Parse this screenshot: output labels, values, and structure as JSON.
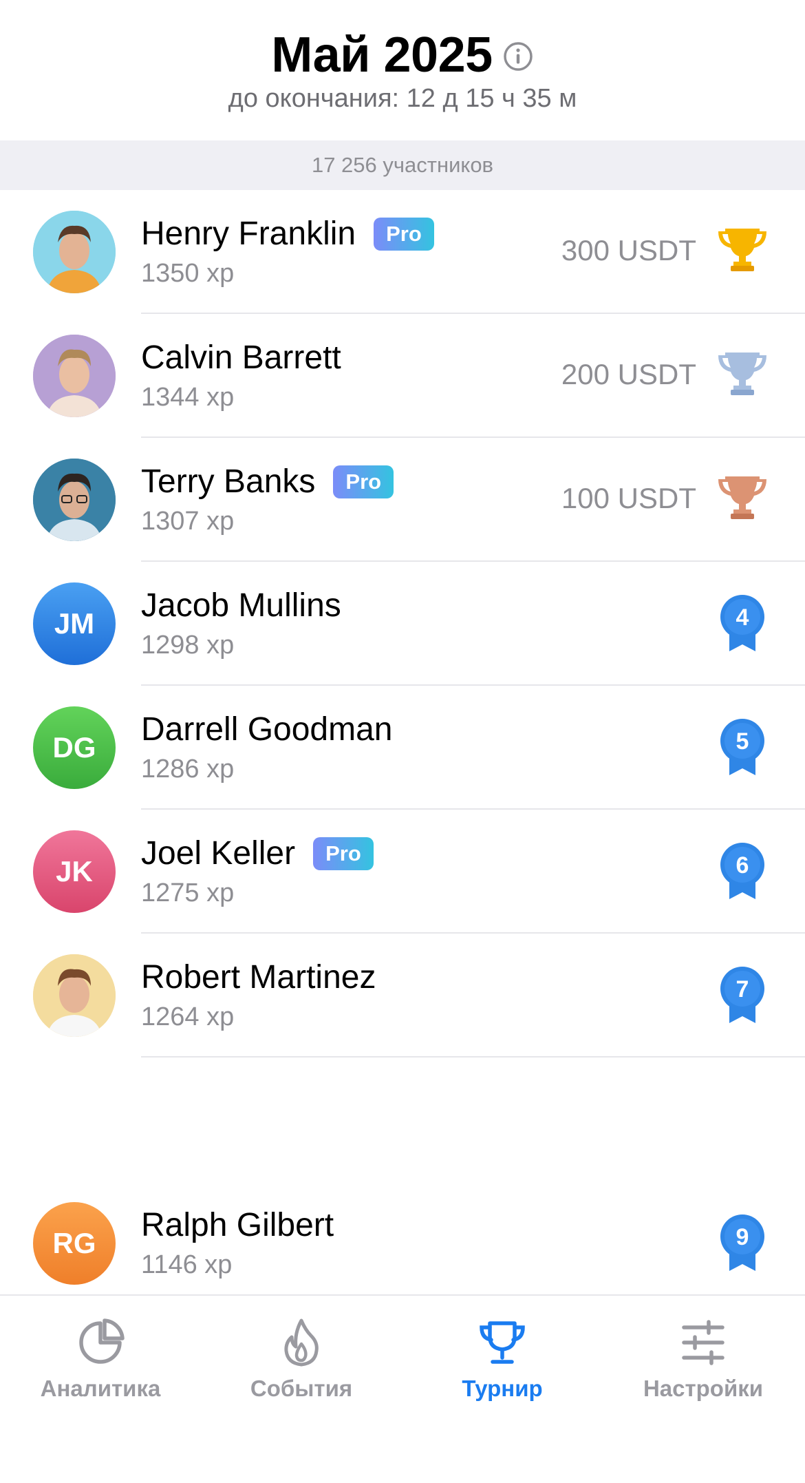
{
  "header": {
    "title": "Май 2025",
    "countdown": "до окончания: 12 д 15 ч 35 м",
    "participants": "17 256 участников"
  },
  "players": [
    {
      "name": "Henry Franklin",
      "pro": true,
      "xp": "1350 xp",
      "prize": "300 USDT",
      "award": "gold-trophy-icon",
      "avatar": "photo"
    },
    {
      "name": "Calvin Barrett",
      "pro": false,
      "xp": "1344 xp",
      "prize": "200 USDT",
      "award": "silver-trophy-icon",
      "avatar": "photo"
    },
    {
      "name": "Terry Banks",
      "pro": true,
      "xp": "1307 xp",
      "prize": "100 USDT",
      "award": "bronze-trophy-icon",
      "avatar": "photo"
    },
    {
      "name": "Jacob Mullins",
      "pro": false,
      "xp": "1298 xp",
      "rank": "4",
      "initials": "JM",
      "avatar_color": "#2f86e6"
    },
    {
      "name": "Darrell Goodman",
      "pro": false,
      "xp": "1286 xp",
      "rank": "5",
      "initials": "DG",
      "avatar_color": "#4cc24a"
    },
    {
      "name": "Joel Keller",
      "pro": true,
      "xp": "1275 xp",
      "rank": "6",
      "initials": "JK",
      "avatar_color": "#e8527a"
    },
    {
      "name": "Robert Martinez",
      "pro": false,
      "xp": "1264 xp",
      "rank": "7",
      "avatar": "photo"
    },
    {
      "name": "Ralph Gilbert",
      "pro": false,
      "xp": "1146 xp",
      "rank": "9",
      "initials": "RG",
      "avatar_color": "#f39034"
    }
  ],
  "pro_label": "Pro",
  "tabs": [
    {
      "label": "Аналитика",
      "icon": "pie-chart-icon",
      "active": false
    },
    {
      "label": "События",
      "icon": "flame-icon",
      "active": false
    },
    {
      "label": "Турнир",
      "icon": "trophy-icon",
      "active": true
    },
    {
      "label": "Настройки",
      "icon": "sliders-icon",
      "active": false
    }
  ],
  "colors": {
    "accent": "#1a7cf0",
    "gold": "#f7b500",
    "silver": "#a7bedf",
    "bronze": "#d98c6a",
    "rank_badge": "#2f86e6"
  }
}
